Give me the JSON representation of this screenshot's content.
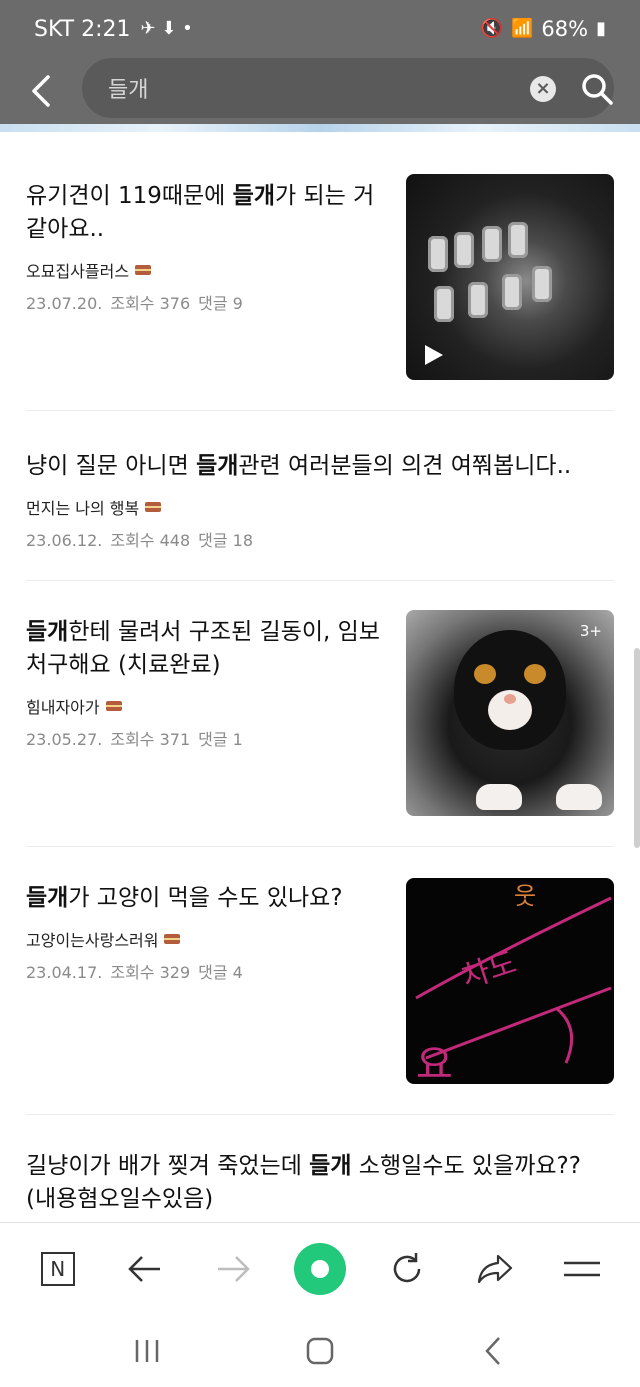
{
  "status_bar": {
    "carrier_time": "SKT 2:21",
    "battery": "68%"
  },
  "search": {
    "query": "들개"
  },
  "articles": [
    {
      "title_before": "유기견이 119때문에 ",
      "keyword": "들개",
      "title_after": "가 되는 거같아요..",
      "author": "오묘집사플러스",
      "date": "23.07.20.",
      "views": "조회수 376",
      "comments": "댓글 9",
      "thumbnail": "video"
    },
    {
      "title_before": "냥이 질문 아니면 ",
      "keyword": "들개",
      "title_after": "관련 여러분들의 의견 여쭤봅니다..",
      "author": "먼지는 나의 행복",
      "date": "23.06.12.",
      "views": "조회수 448",
      "comments": "댓글 18"
    },
    {
      "title_before": "",
      "keyword": "들개",
      "title_after": "한테 물려서 구조된 길동이, 임보처구해요 (치료완료)",
      "author": "힘내자아가",
      "date": "23.05.27.",
      "views": "조회수 371",
      "comments": "댓글 1",
      "thumbnail_badge": "3+"
    },
    {
      "title_before": "",
      "keyword": "들개",
      "title_after": "가 고양이 먹을 수도 있나요?",
      "author": "고양이는사랑스러워",
      "date": "23.04.17.",
      "views": "조회수 329",
      "comments": "댓글 4",
      "thumbnail_text": [
        "차도",
        "요"
      ]
    },
    {
      "title_before": "길냥이가 배가 찢겨 죽었는데 ",
      "keyword": "들개",
      "title_after": " 소행일수도 있을까요?? (내용혐오일수있음)"
    }
  ],
  "toolbar": {
    "naver_label": "N"
  },
  "colors": {
    "accent_green": "#22c97a",
    "header_gray": "#6b6b6b"
  }
}
